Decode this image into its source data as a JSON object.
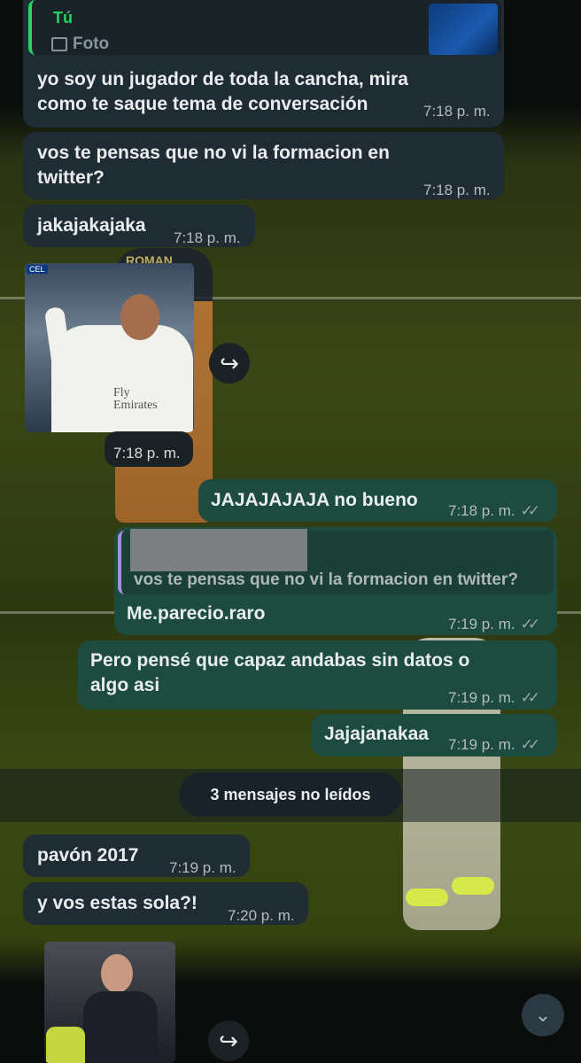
{
  "reply_header": {
    "author": "Tú",
    "media_label": "Foto",
    "media_icon": "photo-icon"
  },
  "messages": [
    {
      "id": "m1",
      "dir": "in",
      "lines": [
        "yo soy un jugador de toda la cancha, mira",
        "como te saque tema de conversación"
      ],
      "time": "7:18 p. m."
    },
    {
      "id": "m2",
      "dir": "in",
      "lines": [
        "vos te pensas que no vi la formacion en",
        "twitter?"
      ],
      "time": "7:18 p. m."
    },
    {
      "id": "m3",
      "dir": "in",
      "lines": [
        "jakajakajaka"
      ],
      "time": "7:18 p. m."
    },
    {
      "id": "m4",
      "dir": "in",
      "type": "image",
      "time": "7:18 p. m.",
      "image_caption_left": "CEL",
      "image_text": "Fly Emirates"
    },
    {
      "id": "m5",
      "dir": "out",
      "lines": [
        "JAJAJAJAJA no bueno"
      ],
      "time": "7:18 p. m.",
      "status": "✓✓"
    },
    {
      "id": "m6",
      "dir": "out",
      "quoted": "vos te pensas que no vi la formacion en twitter?",
      "lines": [
        "Me.parecio.raro"
      ],
      "time": "7:19 p. m.",
      "status": "✓✓"
    },
    {
      "id": "m7",
      "dir": "out",
      "lines": [
        "Pero pensé que capaz andabas sin datos o",
        "algo asi"
      ],
      "time": "7:19 p. m.",
      "status": "✓✓"
    },
    {
      "id": "m8",
      "dir": "out",
      "lines": [
        "Jajajanakaa"
      ],
      "time": "7:19 p. m.",
      "status": "✓✓"
    },
    {
      "id": "m9",
      "dir": "in",
      "lines": [
        "pavón 2017"
      ],
      "time": "7:19 p. m."
    },
    {
      "id": "m10",
      "dir": "in",
      "lines": [
        "y vos estas sola?!"
      ],
      "time": "7:20 p. m."
    },
    {
      "id": "m11",
      "dir": "in",
      "type": "image"
    }
  ],
  "unread_banner": "3 mensajes no leídos",
  "background_text": "ROMAN",
  "colors": {
    "incoming_bubble": "#202c33",
    "outgoing_bubble": "#1d4b40",
    "quote_bar": "#a58ee0",
    "reply_bar": "#25d366"
  }
}
